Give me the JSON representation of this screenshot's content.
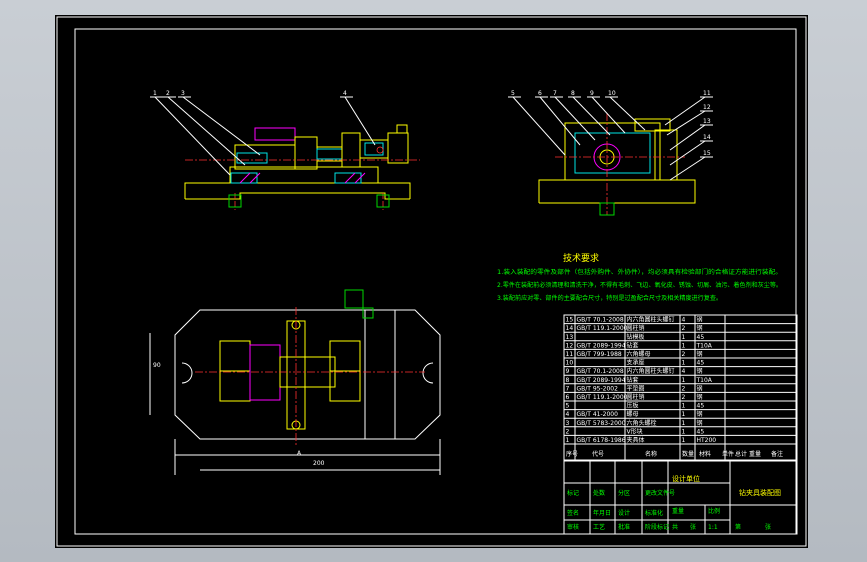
{
  "tech_requirements": {
    "title": "技术要求",
    "lines": [
      "1.装入装配的零件及部件（包括外购件、外协件），均必须具有检验部门的合格证方能进行装配。",
      "2.零件在装配前必须清理和清洗干净，不得有毛刺、飞边、氧化皮、锈蚀、切屑、油污、着色剂和灰尘等。",
      "3.装配前应对零、部件的主要配合尺寸，特别是过盈配合尺寸及相关精度进行复查。"
    ]
  },
  "balloons": [
    "1",
    "2",
    "3",
    "4",
    "5",
    "6",
    "7",
    "8",
    "9",
    "10",
    "11",
    "12",
    "13",
    "14",
    "15"
  ],
  "dimensions": {
    "height": "90",
    "width": "200",
    "section_mark": "A"
  },
  "bom": {
    "rows": [
      [
        "15",
        "GB/T 70.1-2008",
        "内六角圆柱头螺钉",
        "4",
        "钢"
      ],
      [
        "14",
        "GB/T 119.1-2000",
        "圆柱销",
        "2",
        "钢"
      ],
      [
        "13",
        "",
        "钻模板",
        "1",
        "45"
      ],
      [
        "12",
        "GB/T 2089-1994",
        "钻套",
        "1",
        "T10A"
      ],
      [
        "11",
        "GB/T 799-1988",
        "六角螺母",
        "2",
        "钢"
      ],
      [
        "10",
        "",
        "支承座",
        "1",
        "45"
      ],
      [
        "9",
        "GB/T 70.1-2008",
        "内六角圆柱头螺钉",
        "4",
        "钢"
      ],
      [
        "8",
        "GB/T 2089-1994",
        "钻套",
        "1",
        "T10A"
      ],
      [
        "7",
        "GB/T 95-2002",
        "平垫圈",
        "2",
        "钢"
      ],
      [
        "6",
        "GB/T 119.1-2000",
        "圆柱销",
        "2",
        "钢"
      ],
      [
        "5",
        "",
        "压板",
        "1",
        "45"
      ],
      [
        "4",
        "GB/T 41-2000",
        "螺母",
        "1",
        "钢"
      ],
      [
        "3",
        "GB/T 5783-2000",
        "六角头螺栓",
        "1",
        "钢"
      ],
      [
        "2",
        "",
        "V形块",
        "1",
        "45"
      ],
      [
        "1",
        "GB/T 6178-1986",
        "夹具体",
        "1",
        "HT200"
      ]
    ],
    "header": [
      "序号",
      "代号",
      "名称",
      "数量",
      "材料",
      "单件",
      "总计",
      "重量",
      "备注"
    ]
  },
  "title_block": {
    "drawing_name": "钻夹具装配图",
    "company": "设计单位",
    "cells": [
      "标记",
      "处数",
      "分区",
      "更改文件号",
      "签名",
      "年月日",
      "设计",
      "标准化",
      "审核",
      "工艺",
      "批准",
      "阶段标记",
      "重量",
      "比例",
      "1:1",
      "共",
      "张",
      "第",
      "张"
    ]
  },
  "colors": {
    "background": "#000000",
    "frame": "#ffffff",
    "outline": "#ffff00",
    "hidden": "#00e5e5",
    "center": "#ff3030",
    "annotation": "#00d800",
    "hatch": "#ff00ff"
  }
}
